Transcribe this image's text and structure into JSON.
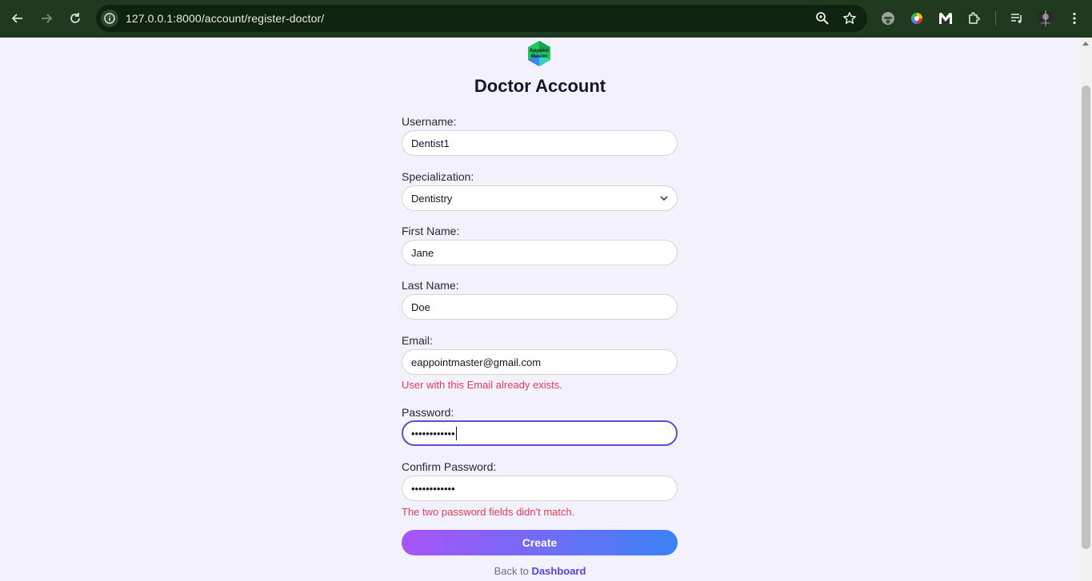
{
  "browser": {
    "url": "127.0.0.1:8000/account/register-doctor/"
  },
  "page": {
    "logo_text": "Appoint Master",
    "title": "Doctor Account"
  },
  "form": {
    "username": {
      "label": "Username:",
      "value": "Dentist1"
    },
    "specialization": {
      "label": "Specialization:",
      "value": "Dentistry"
    },
    "first_name": {
      "label": "First Name:",
      "value": "Jane"
    },
    "last_name": {
      "label": "Last Name:",
      "value": "Doe"
    },
    "email": {
      "label": "Email:",
      "value": "eappointmaster@gmail.com",
      "error": "User with this Email already exists."
    },
    "password": {
      "label": "Password:",
      "value": "••••••••••••"
    },
    "confirm_password": {
      "label": "Confirm Password:",
      "value": "••••••••••••",
      "error": "The two password fields didn't match."
    },
    "submit_label": "Create"
  },
  "footer": {
    "back_prefix": "Back to ",
    "back_link": "Dashboard"
  },
  "colors": {
    "error": "#e23d5c",
    "accent": "#5b4fd1",
    "chrome": "#1f3a1f"
  }
}
